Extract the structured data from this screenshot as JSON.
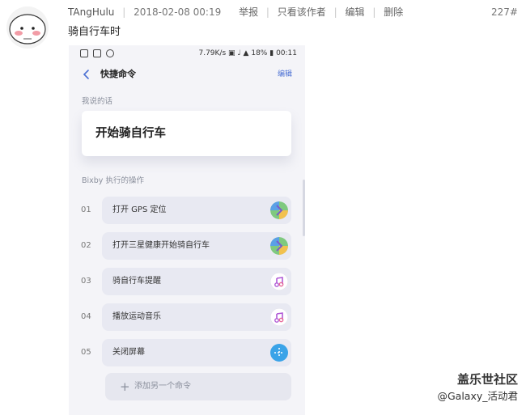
{
  "post": {
    "username": "TAngHulu",
    "date": "2018-02-08 00:19",
    "actions": [
      "举报",
      "只看该作者",
      "编辑",
      "删除"
    ],
    "floor": "227#",
    "text": "骑自行车时"
  },
  "phone": {
    "status": {
      "left_icons": [
        "notification-icon",
        "image-icon",
        "vpn-icon"
      ],
      "speed": "7.79K/s",
      "battery": "18%",
      "time": "00:11"
    },
    "nav": {
      "title": "快捷命令",
      "edit": "编辑"
    },
    "phrase_label": "我说的话",
    "phrase": "开始骑自行车",
    "actions_label": "Bixby 执行的操作",
    "actions": [
      {
        "num": "01",
        "label": "打开 GPS 定位",
        "icon": "maps-icon"
      },
      {
        "num": "02",
        "label": "打开三星健康开始骑自行车",
        "icon": "maps-icon"
      },
      {
        "num": "03",
        "label": "骑自行车提醒",
        "icon": "music-icon"
      },
      {
        "num": "04",
        "label": "播放运动音乐",
        "icon": "music-icon"
      },
      {
        "num": "05",
        "label": "关闭屏幕",
        "icon": "assistant-icon"
      }
    ],
    "add_label": "添加另一个命令"
  },
  "watermark": {
    "line1": "盖乐世社区",
    "line2": "@Galaxy_活动君"
  },
  "colors": {
    "accent": "#4a6fd3",
    "pill": "#e8e9f2",
    "background": "#f4f4f8"
  }
}
